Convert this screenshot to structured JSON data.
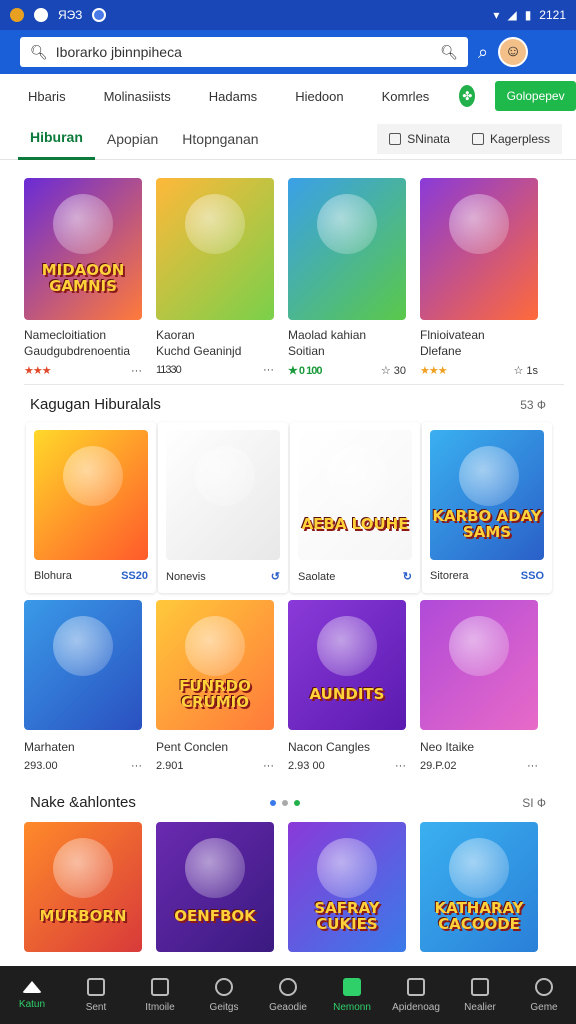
{
  "status": {
    "icons": [
      "notification-icon",
      "messenger-icon",
      "wifi-icon",
      "signal-icon",
      "battery-icon"
    ],
    "left_text": "ЯЭЗ",
    "time": "2121"
  },
  "search": {
    "placeholder": "Iborarko jbinnpiheca"
  },
  "topnav": {
    "items": [
      "Hbaris",
      "Molinasiists",
      "Hadams",
      "Hiedoon",
      "Komrles"
    ],
    "cta": "Golopepev"
  },
  "tabs": {
    "items": [
      "Hiburan",
      "Apopian",
      "Htopnganan"
    ],
    "active": "Hiburan"
  },
  "filters": {
    "a": "SNinata",
    "b": "Kagerpless"
  },
  "row1": [
    {
      "thumb_text": "MIDAOON GAMNIS",
      "title": "Namecloitiation",
      "subtitle": "Gaudgubdrenoentia",
      "rating": "★★★",
      "meta": "···",
      "colors": [
        "#6a2bd6",
        "#ff7a3a"
      ]
    },
    {
      "thumb_text": "",
      "title": "Kaoran",
      "subtitle": "Kuchd Geaninjd",
      "rating": "11330",
      "meta": "···",
      "colors": [
        "#ffb83a",
        "#7ad04a"
      ]
    },
    {
      "thumb_text": "",
      "title": "Maolad kahian",
      "subtitle": "Soitian",
      "rating": "★ 0 100",
      "meta": "☆ 30",
      "colors": [
        "#3aa0e8",
        "#5ac84a"
      ]
    },
    {
      "thumb_text": "",
      "title": "Flnioivatean",
      "subtitle": "Dlefane",
      "rating": "★★★",
      "meta": "☆ 1s",
      "colors": [
        "#8a3ad8",
        "#ff6a3a"
      ]
    }
  ],
  "section2": {
    "title": "Kagugan Hiburalals",
    "right": "53 Ф"
  },
  "row2": [
    {
      "thumb_text": "",
      "label": "Blohura",
      "badge": "SS20",
      "colors": [
        "#ffd82a",
        "#ff5a2a"
      ]
    },
    {
      "thumb_text": "",
      "label": "Nonevis",
      "badge": "↺",
      "colors": [
        "#ffffff",
        "#e8e8e8"
      ]
    },
    {
      "thumb_text": "AEBA LOUHE",
      "label": "Saolate",
      "badge": "↻",
      "colors": [
        "#ffffff",
        "#f6f6f6"
      ]
    },
    {
      "thumb_text": "KARBO ADAY SAMS",
      "label": "Sitorera",
      "badge": "SSO",
      "colors": [
        "#3ab0f0",
        "#2a60c8"
      ]
    }
  ],
  "row3": [
    {
      "thumb_text": "",
      "title": "Marhaten",
      "value": "293.00",
      "meta": "···",
      "colors": [
        "#3a9ae8",
        "#2a50c0"
      ]
    },
    {
      "thumb_text": "FUNRDO CRUMIO",
      "title": "Pent Conclen",
      "value": "2.901",
      "meta": "···",
      "colors": [
        "#ffc83a",
        "#ff7a3a"
      ]
    },
    {
      "thumb_text": "AUNDITS",
      "title": "Nacon Cangles",
      "value": "2.93 00",
      "meta": "···",
      "colors": [
        "#8a3ad8",
        "#5a1ab0"
      ]
    },
    {
      "thumb_text": "",
      "title": "Neo Itaike",
      "value": "29.P.02",
      "meta": "···",
      "colors": [
        "#b04ad8",
        "#e86ac8"
      ]
    }
  ],
  "section3": {
    "title": "Nake &ahlontes",
    "right": "SI Ф"
  },
  "row4": [
    {
      "thumb_text": "MURBORN",
      "colors": [
        "#ff8a2a",
        "#d83a3a"
      ]
    },
    {
      "thumb_text": "OENFBOK",
      "colors": [
        "#6a2ab0",
        "#3a1a80"
      ]
    },
    {
      "thumb_text": "SAFRAY CUKIES",
      "colors": [
        "#8a3ad8",
        "#3a7ae8"
      ]
    },
    {
      "thumb_text": "KATHARAY CACOODE",
      "colors": [
        "#3ab0f0",
        "#2a80d8"
      ]
    }
  ],
  "bottomnav": [
    {
      "label": "Katun",
      "icon": "home-icon"
    },
    {
      "label": "Sent",
      "icon": "store-icon"
    },
    {
      "label": "Itmoile",
      "icon": "calendar-icon"
    },
    {
      "label": "Geitgs",
      "icon": "circle-icon"
    },
    {
      "label": "Geaodie",
      "icon": "compass-icon"
    },
    {
      "label": "Nemonn",
      "icon": "game-icon",
      "active": true
    },
    {
      "label": "Apidenoag",
      "icon": "book-icon"
    },
    {
      "label": "Nealier",
      "icon": "bell-icon"
    },
    {
      "label": "Geme",
      "icon": "person-icon"
    }
  ]
}
